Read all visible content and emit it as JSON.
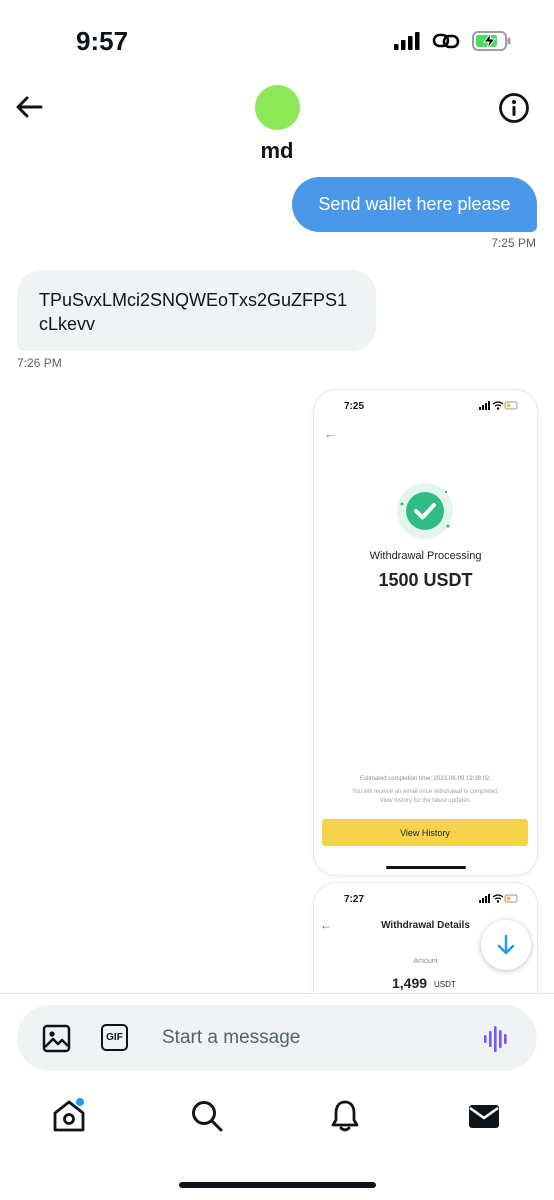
{
  "status_bar": {
    "time": "9:57"
  },
  "header": {
    "contact_name": "md",
    "avatar_color": "#8ee858"
  },
  "messages": [
    {
      "direction": "out",
      "text": "Send wallet here please",
      "time": "7:25 PM"
    },
    {
      "direction": "in",
      "text": "TPuSvxLMci2SNQWEoTxs2GuZFPS1cLkevv",
      "time": "7:26 PM"
    }
  ],
  "screenshot1": {
    "time": "7:25",
    "title": "Withdrawal Processing",
    "amount": "1500 USDT",
    "estimated": "Estimated completion time: 2023-06-09 19:38:02.",
    "note_line1": "You will receive an email once withdrawal is completed.",
    "note_line2": "View history for the latest updates.",
    "button": "View History",
    "button_color": "#f5d34c"
  },
  "screenshot2": {
    "time": "7:27",
    "title": "Withdrawal Details",
    "amount_label": "Amount",
    "amount": "1,499",
    "unit": "USDT"
  },
  "composer": {
    "placeholder": "Start a message"
  },
  "colors": {
    "accent": "#4a99e9",
    "incoming_bubble": "#eff3f4",
    "voice": "#7856ff"
  },
  "icons": {
    "back": "arrow-left-icon",
    "info": "info-icon",
    "image": "image-icon",
    "gif": "gif-icon",
    "voice": "voice-wave-icon",
    "home": "home-icon",
    "search": "search-icon",
    "notifications": "bell-icon",
    "messages": "envelope-icon",
    "scroll_down": "arrow-down-icon"
  },
  "tabs": {
    "home_has_notification": true
  }
}
